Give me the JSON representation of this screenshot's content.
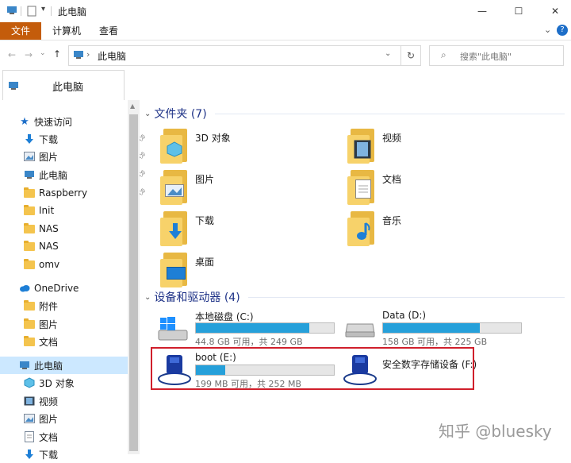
{
  "window": {
    "title": "此电脑",
    "minimize_icon": "minimize-icon",
    "maximize_icon": "maximize-icon",
    "close_icon": "close-icon"
  },
  "ribbon": {
    "tabs": [
      "文件",
      "计算机",
      "查看"
    ]
  },
  "address": {
    "path": "此电脑",
    "search_placeholder": "搜索\"此电脑\""
  },
  "tab_strip": {
    "label": "此电脑"
  },
  "nav": {
    "quick_access": "快速访问",
    "items": [
      {
        "label": "下载",
        "icon": "download-icon",
        "pinned": true
      },
      {
        "label": "图片",
        "icon": "pictures-icon",
        "pinned": true
      },
      {
        "label": "此电脑",
        "icon": "computer-icon",
        "pinned": true
      },
      {
        "label": "Raspberry",
        "icon": "folder-icon",
        "pinned": true
      },
      {
        "label": "Init",
        "icon": "folder-icon",
        "pinned": false
      },
      {
        "label": "NAS",
        "icon": "folder-icon",
        "pinned": false
      },
      {
        "label": "NAS",
        "icon": "folder-icon",
        "pinned": false
      },
      {
        "label": "omv",
        "icon": "folder-icon",
        "pinned": false
      }
    ],
    "onedrive": "OneDrive",
    "onedrive_items": [
      "附件",
      "图片",
      "文档"
    ],
    "this_pc": "此电脑",
    "this_pc_items": [
      "3D 对象",
      "视频",
      "图片",
      "文档",
      "下载"
    ]
  },
  "main": {
    "folders_header": "文件夹 (7)",
    "folders": [
      {
        "label": "3D 对象",
        "icon": "3d-objects-icon"
      },
      {
        "label": "视频",
        "icon": "videos-icon"
      },
      {
        "label": "图片",
        "icon": "pictures-icon"
      },
      {
        "label": "文档",
        "icon": "documents-icon"
      },
      {
        "label": "下载",
        "icon": "downloads-icon"
      },
      {
        "label": "音乐",
        "icon": "music-icon"
      },
      {
        "label": "桌面",
        "icon": "desktop-icon"
      }
    ],
    "drives_header": "设备和驱动器 (4)",
    "drives": [
      {
        "label": "本地磁盘 (C:)",
        "sub": "44.8 GB 可用，共 249 GB",
        "fill": 0.82,
        "icon": "windows-drive-icon"
      },
      {
        "label": "Data (D:)",
        "sub": "158 GB 可用，共 225 GB",
        "fill": 0.7,
        "icon": "hard-drive-icon"
      },
      {
        "label": "boot (E:)",
        "sub": "199 MB 可用，共 252 MB",
        "fill": 0.21,
        "icon": "removable-drive-icon"
      },
      {
        "label": "安全数字存储设备 (F:)",
        "sub": "",
        "fill": null,
        "icon": "sd-card-drive-icon"
      }
    ]
  },
  "watermark": "知乎 @bluesky",
  "colors": {
    "accent": "#26a0da",
    "file_tab": "#c45c0b",
    "highlight": "#d01f2b"
  }
}
